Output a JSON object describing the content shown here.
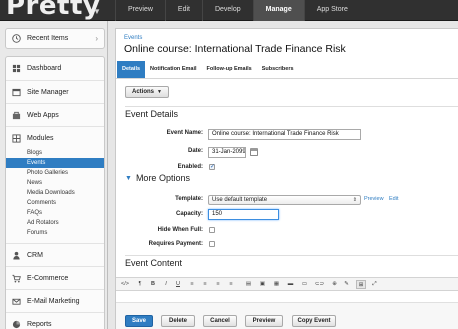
{
  "app": {
    "logo_text": "Pretty",
    "logo_caret": "▼"
  },
  "topnav": {
    "items": [
      "Preview",
      "Edit",
      "Develop",
      "Manage",
      "App Store"
    ],
    "active": "Manage"
  },
  "sidebar": {
    "recent_items_label": "Recent Items",
    "recent_chevron": "›",
    "menu": [
      {
        "label": "Dashboard",
        "icon": "dashboard-icon"
      },
      {
        "label": "Site Manager",
        "icon": "site-manager-icon"
      },
      {
        "label": "Web Apps",
        "icon": "web-apps-icon"
      },
      {
        "label": "Modules",
        "icon": "modules-icon"
      },
      {
        "label": "CRM",
        "icon": "crm-icon"
      },
      {
        "label": "E-Commerce",
        "icon": "cart-icon"
      },
      {
        "label": "E-Mail Marketing",
        "icon": "email-icon"
      },
      {
        "label": "Reports",
        "icon": "reports-icon"
      }
    ],
    "module_subitems": [
      "Blogs",
      "Events",
      "Photo Galleries",
      "News",
      "Media Downloads",
      "Comments",
      "FAQs",
      "Ad Rotators",
      "Forums"
    ],
    "selected_subitem": "Events"
  },
  "main": {
    "breadcrumb": "Events",
    "title": "Online course: International Trade Finance Risk",
    "tabs": [
      "Details",
      "Notification Email",
      "Follow-up Emails",
      "Subscribers"
    ],
    "active_tab": "Details",
    "actions_label": "Actions",
    "actions_caret": "▼",
    "event_details_heading": "Event Details",
    "fields": {
      "event_name_label": "Event Name:",
      "event_name_value": "Online course: International Trade Finance Risk",
      "date_label": "Date:",
      "date_value": "31-Jan-2099",
      "enabled_label": "Enabled:",
      "enabled_checked": true
    },
    "more_options_heading": "More Options",
    "more_options_toggle": "▼",
    "more_options": {
      "template_label": "Template:",
      "template_value": "Use default template",
      "select_arrows": "⇕",
      "preview_link": "Preview",
      "edit_link": "Edit",
      "capacity_label": "Capacity:",
      "capacity_value": "150",
      "hide_when_full_label": "Hide When Full:",
      "requires_payment_label": "Requires Payment:"
    },
    "event_content_heading": "Event Content",
    "editor_toolbar": [
      "</>",
      "¶",
      "B",
      "I",
      "U",
      "≡",
      "≡",
      "≡",
      "≡",
      "▤",
      "▣",
      "▦",
      "▬",
      "▭",
      "⊂⊃",
      "⊕",
      "✎",
      "⊞",
      "⤢"
    ],
    "footer_buttons": [
      "Save",
      "Delete",
      "Cancel",
      "Preview",
      "Copy Event"
    ]
  },
  "colors": {
    "accent": "#2f7dc2",
    "topbar": "#303030",
    "sidebar_bg": "#e9e9e9"
  }
}
